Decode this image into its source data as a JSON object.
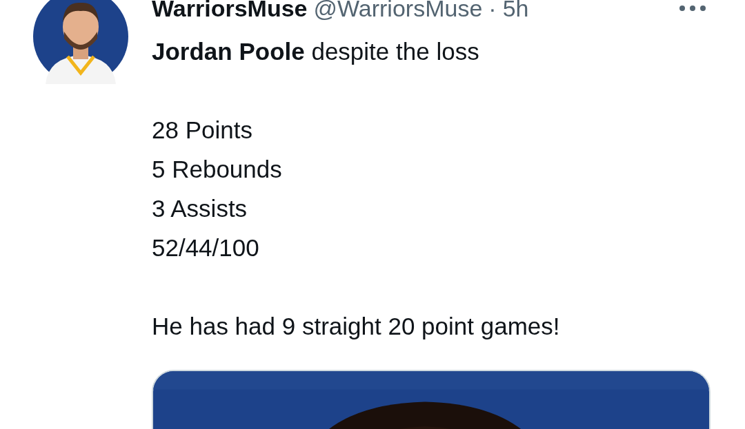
{
  "tweet": {
    "author": {
      "name": "WarriorsMuse",
      "handle": "@WarriorsMuse",
      "separator": "·",
      "time": "5h"
    },
    "text": "**Jordan Poole** despite the loss\n\n28 Points\n5 Rebounds\n3 Assists\n52/44/100\n\nHe has had 9 straight 20 point games!"
  }
}
